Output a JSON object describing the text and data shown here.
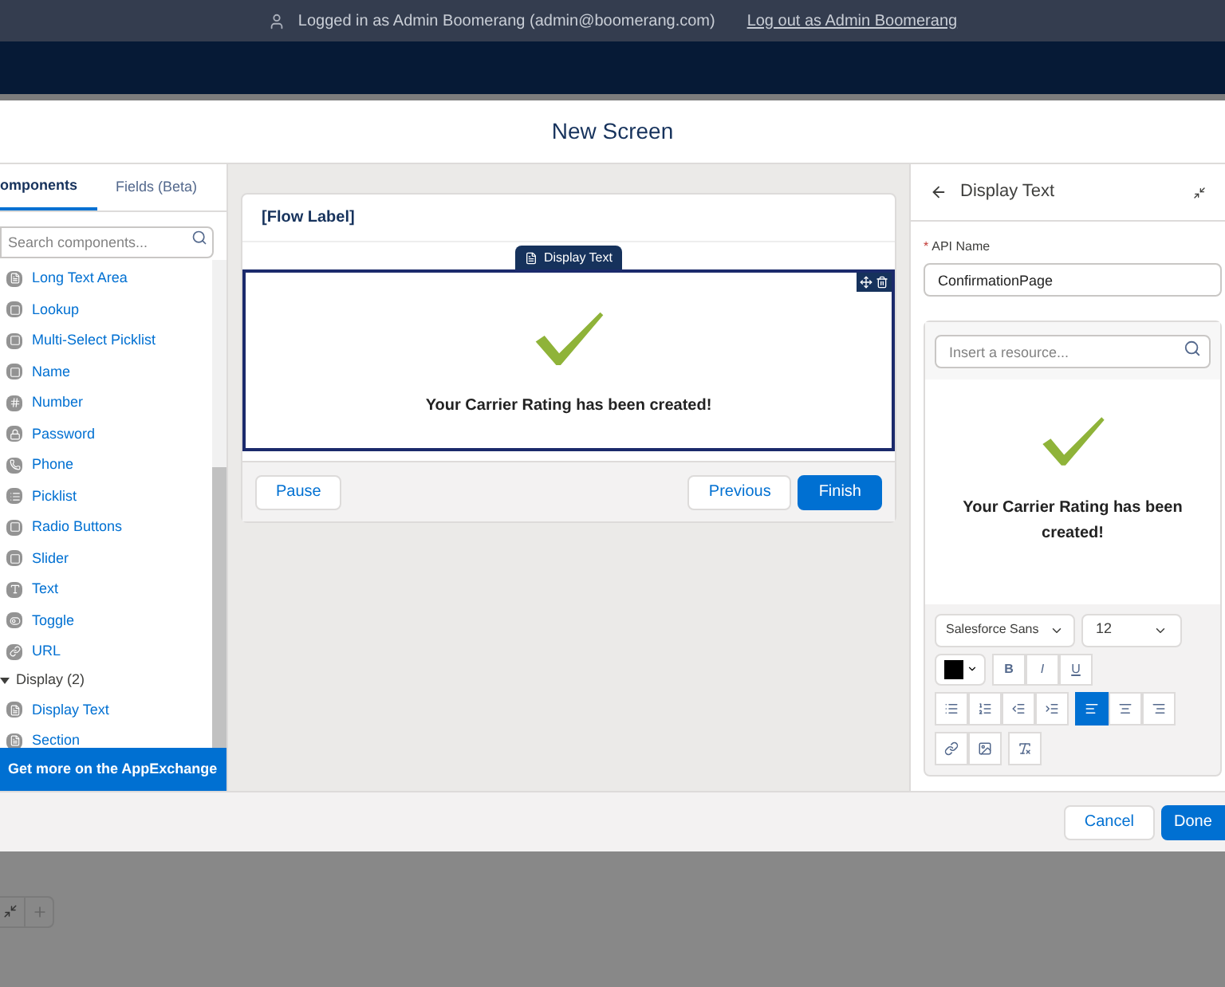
{
  "top_bar": {
    "logged_in": "Logged in as Admin Boomerang (admin@boomerang.com)",
    "logout_link": "Log out as Admin Boomerang"
  },
  "modal": {
    "title": "New Screen"
  },
  "left_panel": {
    "tabs": [
      {
        "label": "omponents",
        "selected": true
      },
      {
        "label": "Fields (Beta)",
        "selected": false
      }
    ],
    "search": {
      "placeholder": "Search components..."
    },
    "items": [
      {
        "label": "Long Text Area"
      },
      {
        "label": "Lookup"
      },
      {
        "label": "Multi-Select Picklist"
      },
      {
        "label": "Name"
      },
      {
        "label": "Number"
      },
      {
        "label": "Password"
      },
      {
        "label": "Phone"
      },
      {
        "label": "Picklist"
      },
      {
        "label": "Radio Buttons"
      },
      {
        "label": "Slider"
      },
      {
        "label": "Text"
      },
      {
        "label": "Toggle"
      },
      {
        "label": "URL"
      }
    ],
    "category": {
      "label": "Display (2)",
      "expanded": true,
      "children": [
        {
          "label": "Display Text"
        },
        {
          "label": "Section"
        }
      ]
    },
    "appexchange_button": "Get more on the AppExchange"
  },
  "canvas": {
    "flow_label": "[Flow Label]",
    "component_tab": "Display Text",
    "message": "Your Carrier Rating has been created!",
    "buttons": [
      {
        "label": "Pause",
        "kind": "neutral"
      },
      {
        "label": "Previous",
        "kind": "neutral"
      },
      {
        "label": "Finish",
        "kind": "brand"
      }
    ]
  },
  "properties": {
    "title": "Display Text",
    "api_name": {
      "required_mark": "*",
      "label": "API Name",
      "value": "ConfirmationPage"
    },
    "resource_search": {
      "placeholder": "Insert a resource..."
    },
    "preview_message": "Your Carrier Rating has been created!",
    "font": "Salesforce Sans",
    "size": "12",
    "format_buttons": [
      "B",
      "I",
      "U"
    ],
    "align_buttons": [
      {
        "kind": "left",
        "selected": true
      },
      {
        "kind": "center",
        "selected": false
      },
      {
        "kind": "right",
        "selected": false
      }
    ]
  },
  "footer": {
    "buttons": [
      {
        "label": "Cancel",
        "kind": "neutral"
      },
      {
        "label": "Done",
        "kind": "brand"
      }
    ]
  }
}
